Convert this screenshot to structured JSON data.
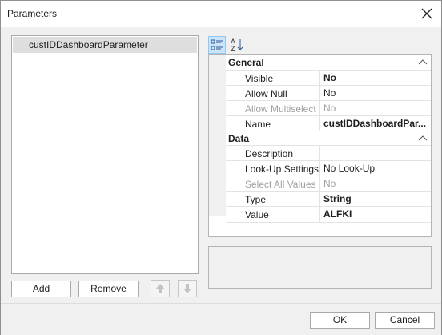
{
  "window": {
    "title": "Parameters"
  },
  "parameters": {
    "items": [
      {
        "label": "custIDDashboardParameter",
        "selected": true
      }
    ]
  },
  "list_buttons": {
    "add": "Add",
    "remove": "Remove",
    "move_up_icon": "arrow-up-icon",
    "move_down_icon": "arrow-down-icon"
  },
  "property_grid": {
    "toolbar": {
      "categorized_icon": "categorized-icon",
      "alphabetical_icon": "sort-alphabetical-icon"
    },
    "categories": [
      {
        "name": "General",
        "rows": [
          {
            "name": "Visible",
            "value": "No",
            "bold": true,
            "disabled": false
          },
          {
            "name": "Allow Null",
            "value": "No",
            "bold": false,
            "disabled": false
          },
          {
            "name": "Allow Multiselect",
            "value": "No",
            "bold": false,
            "disabled": true
          },
          {
            "name": "Name",
            "value": "custIDDashboardPar...",
            "bold": true,
            "disabled": false
          }
        ]
      },
      {
        "name": "Data",
        "rows": [
          {
            "name": "Description",
            "value": "",
            "bold": false,
            "disabled": false
          },
          {
            "name": "Look-Up Settings",
            "value": "No Look-Up",
            "bold": false,
            "disabled": false
          },
          {
            "name": "Select All Values",
            "value": "No",
            "bold": false,
            "disabled": true
          },
          {
            "name": "Type",
            "value": "String",
            "bold": true,
            "disabled": false
          },
          {
            "name": "Value",
            "value": "ALFKI",
            "bold": true,
            "disabled": false
          }
        ]
      }
    ]
  },
  "footer": {
    "ok": "OK",
    "cancel": "Cancel"
  },
  "colors": {
    "selection": "#dedede",
    "toolbar_active": "#cce4f7",
    "disabled_text": "#a0a0a0"
  }
}
